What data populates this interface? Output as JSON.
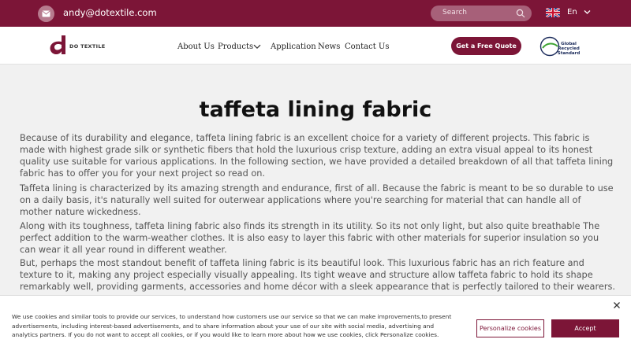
{
  "topbar": {
    "email": "andy@dotextile.com",
    "search_placeholder": "Search",
    "language": "En",
    "colors": {
      "bar": "#7c1537"
    }
  },
  "nav": {
    "logo_text": "DO TEXTILE",
    "items": [
      "About Us",
      "Products",
      "Application",
      "News",
      "Contact Us"
    ],
    "quote_button": "Get a Free Quote",
    "certification_text": "Global Recycled Standard"
  },
  "article": {
    "title": "taffeta lining fabric",
    "paragraphs": [
      "Because of its durability and elegance, taffeta lining fabric is an excellent choice for a variety of different projects. This fabric is made with highest grade silk or synthetic fibers that hold the luxurious crisp texture, adding an extra visual appeal to its honest quality use suitable for various applications. In the following section, we have provided a detailed breakdown of all that taffeta lining fabric has to offer you for your next project so read on.",
      "Taffeta lining is characterized by its amazing strength and endurance, first of all. Because the fabric is meant to be so durable to use on a daily basis, it's naturally well suited for outerwear applications where you're searching for material that can handle all of mother nature wickedness.",
      "Along with its toughness, taffeta lining fabric also finds its strength in its utility. So its not only light, but also quite breathable The perfect addition to the warm-weather clothes. It is also easy to layer this fabric with other materials for superior insulation so you can wear it all year round in different weather.",
      "But, perhaps the most standout benefit of taffeta lining fabric is its beautiful look. This luxurious fabric has an rich feature and texture to it, making any project especially visually appealing. Its tight weave and structure allow taffeta fabric to hold its shape remarkably well, providing garments, accessories and home décor with a sleek appearance that is perfectly tailored to their wearers."
    ]
  },
  "cookie": {
    "text": "We use cookies and similar tools to provide our services, to understand how customers use our service so that we can make improvements,to present advertisements, including interest-based advertisements, and to share information about your use of our site with social media, advertising and analytics partners. If you do not want to accept all cookies, or if you would like to learn more about how we use cookies, click Personalize cookies.",
    "personalize": "Personalize cookies",
    "accept": "Accept"
  }
}
